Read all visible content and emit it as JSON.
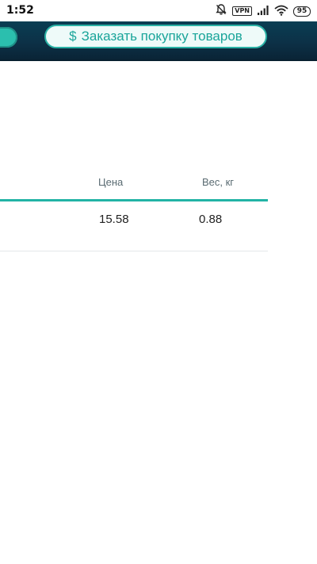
{
  "status_bar": {
    "time": "1:52",
    "vpn": "VPN",
    "battery": "95",
    "icons": [
      "bell-off-icon",
      "vpn-icon",
      "signal-icon",
      "wifi-icon",
      "battery-icon"
    ]
  },
  "app_bar": {
    "order_button_icon": "$",
    "order_button_label": "Заказать покупку товаров",
    "accent_color": "#1aa59a",
    "background_color": "#0c3147"
  },
  "table": {
    "columns": [
      "Цена",
      "Вес, кг"
    ],
    "rows": [
      {
        "price": "15.58",
        "weight": "0.88"
      }
    ]
  }
}
